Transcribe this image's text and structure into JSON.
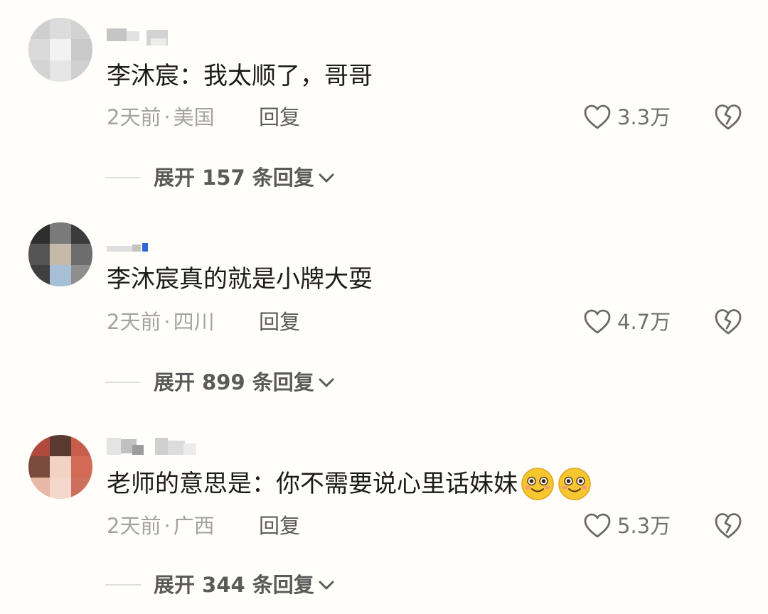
{
  "colors": {
    "background": "#fffefa",
    "text": "#1b1b1b",
    "meta": "#a3a3a3",
    "icon": "#6a6a6a",
    "badge_blue": "#2e66d6"
  },
  "comments": [
    {
      "text": "李沐宸：我太顺了，哥哥",
      "time": "2天前",
      "location": "美国",
      "reply_label": "回复",
      "likes": "3.3万",
      "expand_label": "展开 157 条回复",
      "emojis": []
    },
    {
      "text": "李沐宸真的就是小牌大耍",
      "time": "2天前",
      "location": "四川",
      "reply_label": "回复",
      "likes": "4.7万",
      "expand_label": "展开 899 条回复",
      "emojis": []
    },
    {
      "text": "老师的意思是：你不需要说心里话妹妹",
      "time": "2天前",
      "location": "广西",
      "reply_label": "回复",
      "likes": "5.3万",
      "expand_label": "展开 344 条回复",
      "emojis": [
        "smile-emoji",
        "smile-emoji"
      ]
    }
  ],
  "meta_separator": "·",
  "icons": {
    "like": "heart-outline-icon",
    "dislike": "broken-heart-icon",
    "expand": "chevron-down-icon"
  }
}
